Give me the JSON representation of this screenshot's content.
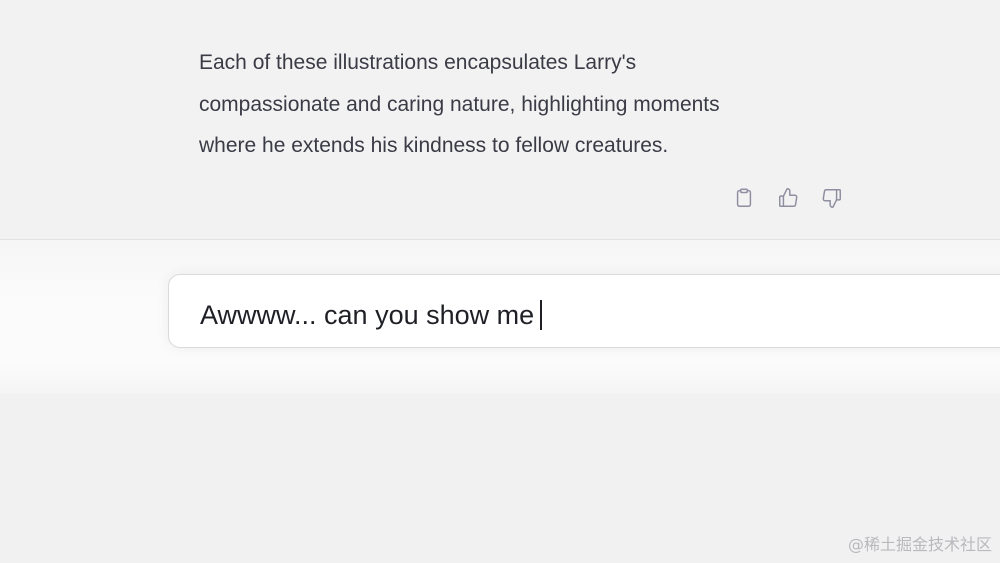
{
  "message": {
    "lines": [
      "Each of these illustrations encapsulates Larry's",
      "compassionate and caring nature, highlighting moments",
      "where he extends his kindness to fellow creatures."
    ]
  },
  "actions": {
    "icons": [
      "clipboard-icon",
      "thumbs-up-icon",
      "thumbs-down-icon"
    ]
  },
  "composer": {
    "value": "Awwww... can you show me"
  },
  "watermark": {
    "text": "@稀土掘金技术社区"
  },
  "colors": {
    "background": "#f1f1f2",
    "text": "#3a3b45",
    "icon": "#8e8ea0",
    "composer_bg": "#ffffff"
  }
}
